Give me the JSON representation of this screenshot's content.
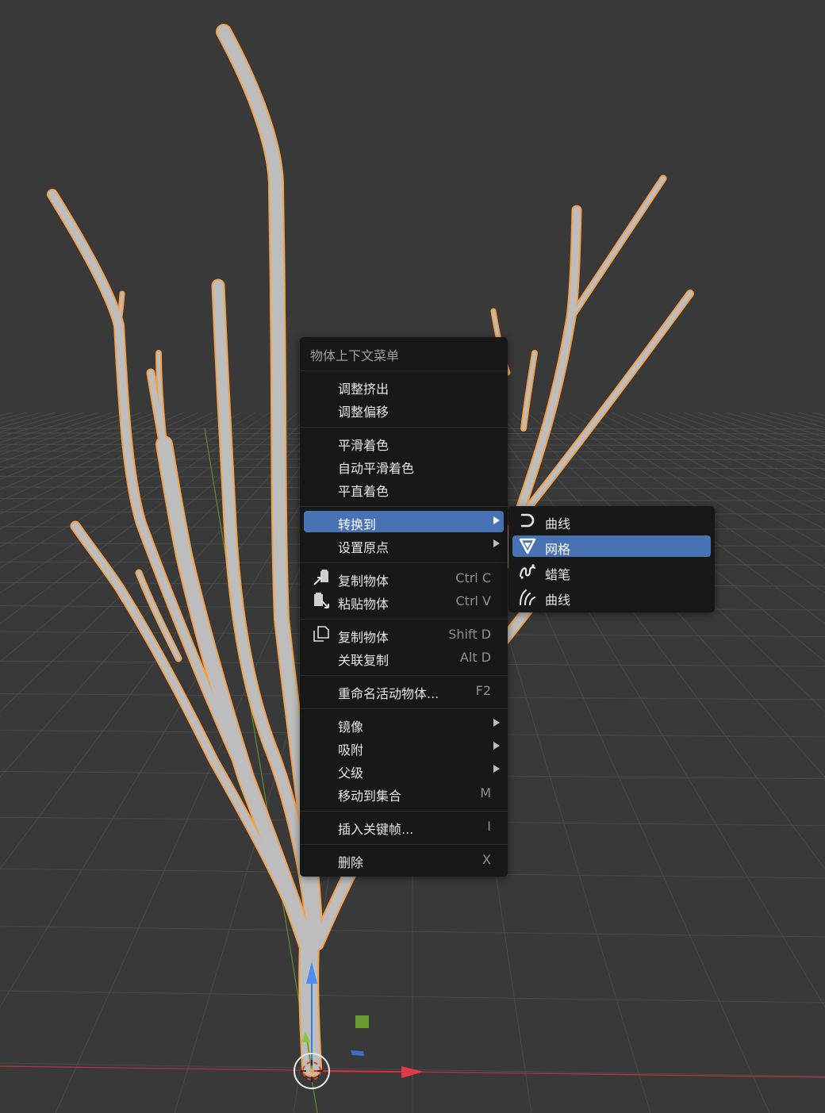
{
  "context_menu": {
    "title": "物体上下文菜单",
    "items": [
      {
        "label": "调整挤出"
      },
      {
        "label": "调整偏移"
      },
      {
        "label": "平滑着色"
      },
      {
        "label": "自动平滑着色"
      },
      {
        "label": "平直着色"
      },
      {
        "label": "转换到",
        "submenu": true,
        "active": true
      },
      {
        "label": "设置原点",
        "submenu": true
      },
      {
        "label": "复制物体",
        "shortcut": "Ctrl C",
        "icon": "copy-object-icon"
      },
      {
        "label": "粘贴物体",
        "shortcut": "Ctrl V",
        "icon": "paste-object-icon"
      },
      {
        "label": "复制物体",
        "shortcut": "Shift D",
        "icon": "duplicate-icon"
      },
      {
        "label": "关联复制",
        "shortcut": "Alt D"
      },
      {
        "label": "重命名活动物体...",
        "shortcut": "F2"
      },
      {
        "label": "镜像",
        "submenu": true
      },
      {
        "label": "吸附",
        "submenu": true
      },
      {
        "label": "父级",
        "submenu": true
      },
      {
        "label": "移动到集合",
        "shortcut": "M"
      },
      {
        "label": "插入关键帧...",
        "shortcut": "I"
      },
      {
        "label": "删除",
        "shortcut": "X"
      }
    ]
  },
  "convert_submenu": {
    "items": [
      {
        "label": "曲线",
        "icon": "curve-icon"
      },
      {
        "label": "网格",
        "icon": "mesh-icon",
        "active": true
      },
      {
        "label": "蜡笔",
        "icon": "grease-pencil-icon"
      },
      {
        "label": "曲线",
        "icon": "curves-hair-icon"
      }
    ]
  },
  "colors": {
    "viewport_bg": "#393939",
    "menu_bg": "#181818",
    "highlight": "#4772b3",
    "selection_outline": "#f5a04a",
    "object_surface": "#bdbdbd",
    "x_axis": "#d6303c",
    "y_axis": "#6e9e2e",
    "z_axis": "#3b7ddb"
  }
}
